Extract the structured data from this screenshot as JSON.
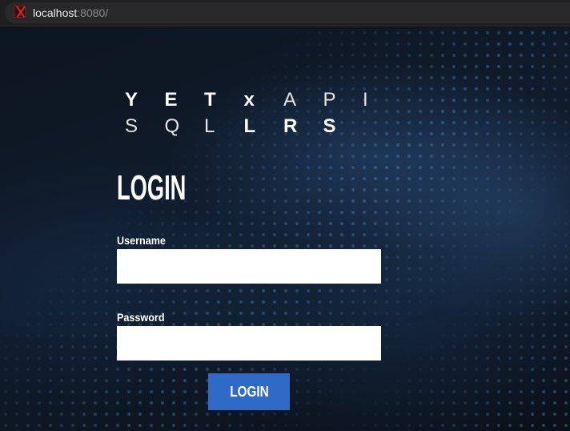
{
  "browser": {
    "host": "localhost",
    "port": ":8080/",
    "favicon": "app-favicon"
  },
  "logo": {
    "row1_bold": [
      "Y",
      "E",
      "T",
      "x"
    ],
    "row1_light": [
      "A",
      "P",
      "I"
    ],
    "row2_light": [
      "S",
      "Q",
      "L"
    ],
    "row2_bold": [
      "L",
      "R",
      "S"
    ]
  },
  "login": {
    "title": "LOGIN",
    "username_label": "Username",
    "username_value": "",
    "password_label": "Password",
    "password_value": "",
    "button_label": "LOGIN"
  },
  "colors": {
    "button": "#2f6bc6",
    "background": "#0d1520"
  }
}
